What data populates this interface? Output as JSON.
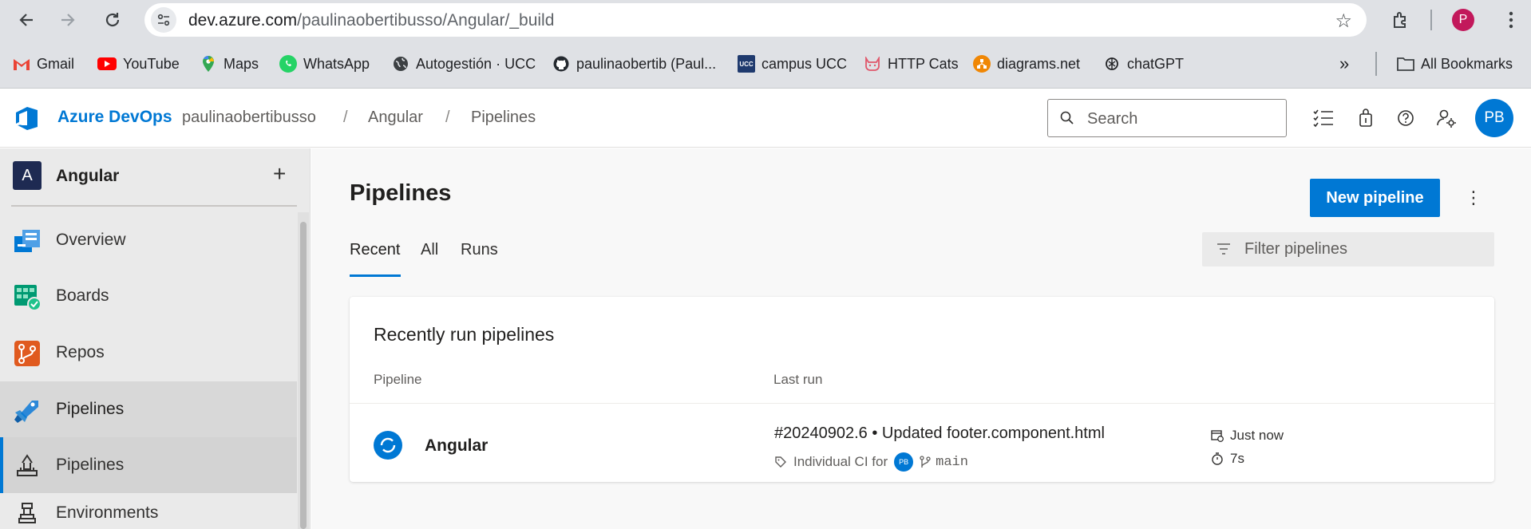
{
  "browser": {
    "url_host": "dev.azure.com",
    "url_path": "/paulinaobertibusso/Angular/_build",
    "profile_initial": "P",
    "bookmarks": [
      {
        "label": "Gmail",
        "icon": "gmail-icon"
      },
      {
        "label": "YouTube",
        "icon": "youtube-icon"
      },
      {
        "label": "Maps",
        "icon": "maps-icon"
      },
      {
        "label": "WhatsApp",
        "icon": "whatsapp-icon"
      },
      {
        "label": "Autogestión · UCC",
        "icon": "globe-icon"
      },
      {
        "label": "paulinaobertib (Paul...",
        "icon": "github-icon"
      },
      {
        "label": "campus UCC",
        "icon": "ucc-icon"
      },
      {
        "label": "HTTP Cats",
        "icon": "cat-icon"
      },
      {
        "label": "diagrams.net",
        "icon": "diagrams-icon"
      },
      {
        "label": "chatGPT",
        "icon": "openai-icon"
      }
    ],
    "all_bookmarks_label": "All Bookmarks"
  },
  "header": {
    "brand": "Azure DevOps",
    "breadcrumbs": [
      "paulinaobertibusso",
      "Angular",
      "Pipelines"
    ],
    "search_placeholder": "Search",
    "avatar_initials": "PB"
  },
  "sidebar": {
    "project_initial": "A",
    "project_name": "Angular",
    "items": [
      {
        "label": "Overview"
      },
      {
        "label": "Boards"
      },
      {
        "label": "Repos"
      },
      {
        "label": "Pipelines"
      },
      {
        "label": "Pipelines"
      },
      {
        "label": "Environments"
      }
    ]
  },
  "main": {
    "title": "Pipelines",
    "new_button": "New pipeline",
    "tabs": [
      "Recent",
      "All",
      "Runs"
    ],
    "selected_tab": "Recent",
    "filter_placeholder": "Filter pipelines",
    "card": {
      "title": "Recently run pipelines",
      "columns": [
        "Pipeline",
        "Last run"
      ],
      "rows": [
        {
          "pipeline": "Angular",
          "run_title": "#20240902.6 • Updated footer.component.html",
          "trigger": "Individual CI for",
          "trigger_avatar": "PB",
          "branch": "main",
          "when": "Just now",
          "duration": "7s"
        }
      ]
    }
  },
  "colors": {
    "accent": "#0078d4",
    "project_avatar": "#1e2a52",
    "profile": "#c2185b"
  }
}
